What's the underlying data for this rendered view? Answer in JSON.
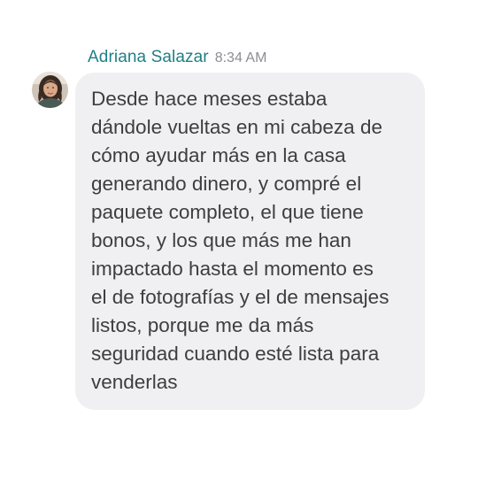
{
  "message": {
    "sender_name": "Adriana Salazar",
    "timestamp": "8:34 AM",
    "avatar_icon": "user-photo-avatar",
    "text": "Desde hace meses estaba\ndándole vueltas en mi cabeza de\ncómo ayudar más en la casa\ngenerando dinero, y compré el\npaquete completo, el que tiene\nbonos, y los que más me han\nimpactado hasta el momento es\nel de fotografías y el de mensajes\nlistos, porque me da más\nseguridad cuando esté lista para\nvenderlas"
  },
  "colors": {
    "sender_name": "#1f7f86",
    "timestamp": "#8e8e93",
    "bubble_background": "#f0f0f2",
    "message_text": "#3d3d42"
  }
}
